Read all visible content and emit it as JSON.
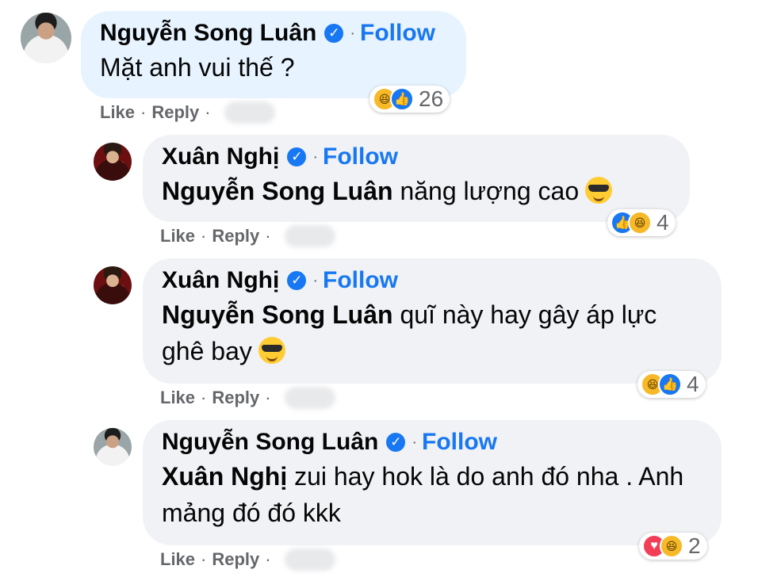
{
  "comments": [
    {
      "author": "Nguyễn Song Luân",
      "follow": "Follow",
      "mention": "",
      "text": "Mặt anh vui thế ?",
      "reaction_count": "26",
      "reaction_icons": [
        "haha-icon",
        "like-icon"
      ],
      "actions": {
        "like": "Like",
        "reply": "Reply"
      }
    },
    {
      "author": "Xuân Nghị",
      "follow": "Follow",
      "mention": "Nguyễn Song Luân",
      "text": " năng lượng cao",
      "reaction_count": "4",
      "reaction_icons": [
        "like-icon",
        "haha-icon"
      ],
      "actions": {
        "like": "Like",
        "reply": "Reply"
      }
    },
    {
      "author": "Xuân Nghị",
      "follow": "Follow",
      "mention": "Nguyễn Song Luân",
      "text": " quĩ này hay gây áp lực ghê bay",
      "reaction_count": "4",
      "reaction_icons": [
        "haha-icon",
        "like-icon"
      ],
      "actions": {
        "like": "Like",
        "reply": "Reply"
      }
    },
    {
      "author": "Nguyễn Song Luân",
      "follow": "Follow",
      "mention": "Xuân Nghị",
      "text": " zui hay hok là do anh đó nha . Anh mảng đó đó kkk",
      "reaction_count": "2",
      "reaction_icons": [
        "love-icon",
        "haha-icon"
      ],
      "actions": {
        "like": "Like",
        "reply": "Reply"
      }
    }
  ],
  "colors": {
    "link": "#1877f2",
    "bubble": "#f0f2f5",
    "bubble_highlight": "#e7f3ff",
    "meta": "#65676b"
  }
}
